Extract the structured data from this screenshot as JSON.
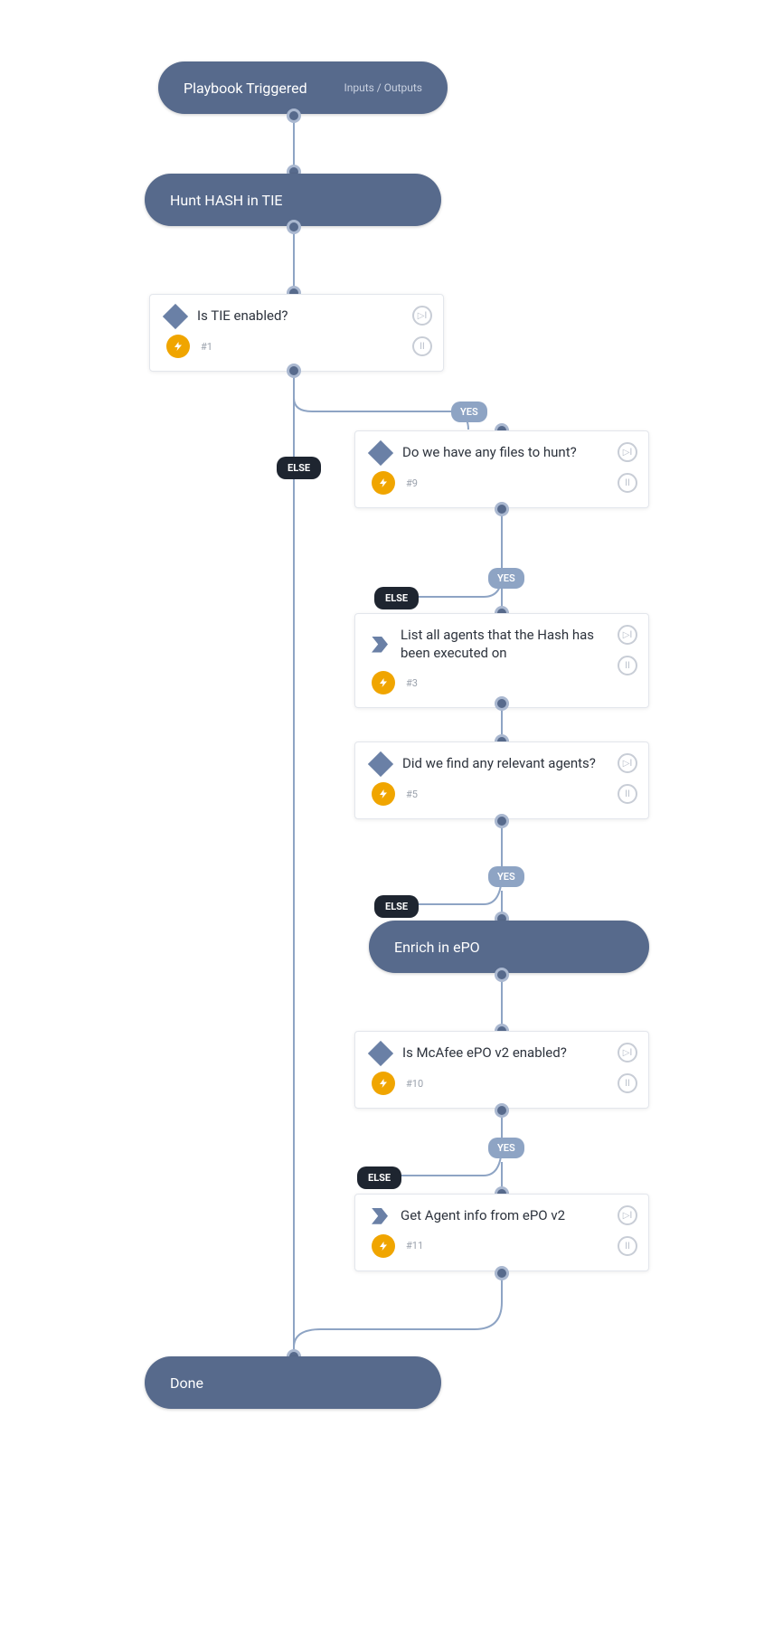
{
  "nodes": {
    "trigger": {
      "label": "Playbook Triggered",
      "sublabel": "Inputs / Outputs"
    },
    "section_tie": {
      "label": "Hunt HASH in TIE"
    },
    "section_epo": {
      "label": "Enrich in ePO"
    },
    "done": {
      "label": "Done"
    }
  },
  "tasks": {
    "tie_enabled": {
      "title": "Is TIE enabled?",
      "num": "#1",
      "icon": "diamond"
    },
    "files_hunt": {
      "title": "Do we have any files to hunt?",
      "num": "#9",
      "icon": "diamond"
    },
    "list_agents": {
      "title": "List all agents that the Hash has been executed on",
      "num": "#3",
      "icon": "chevron"
    },
    "find_agents": {
      "title": "Did we find any relevant agents?",
      "num": "#5",
      "icon": "diamond"
    },
    "epo_enabled": {
      "title": "Is McAfee ePO v2 enabled?",
      "num": "#10",
      "icon": "diamond"
    },
    "get_agent": {
      "title": "Get Agent info from ePO v2",
      "num": "#11",
      "icon": "chevron"
    }
  },
  "branches": {
    "yes": "YES",
    "else": "ELSE"
  }
}
